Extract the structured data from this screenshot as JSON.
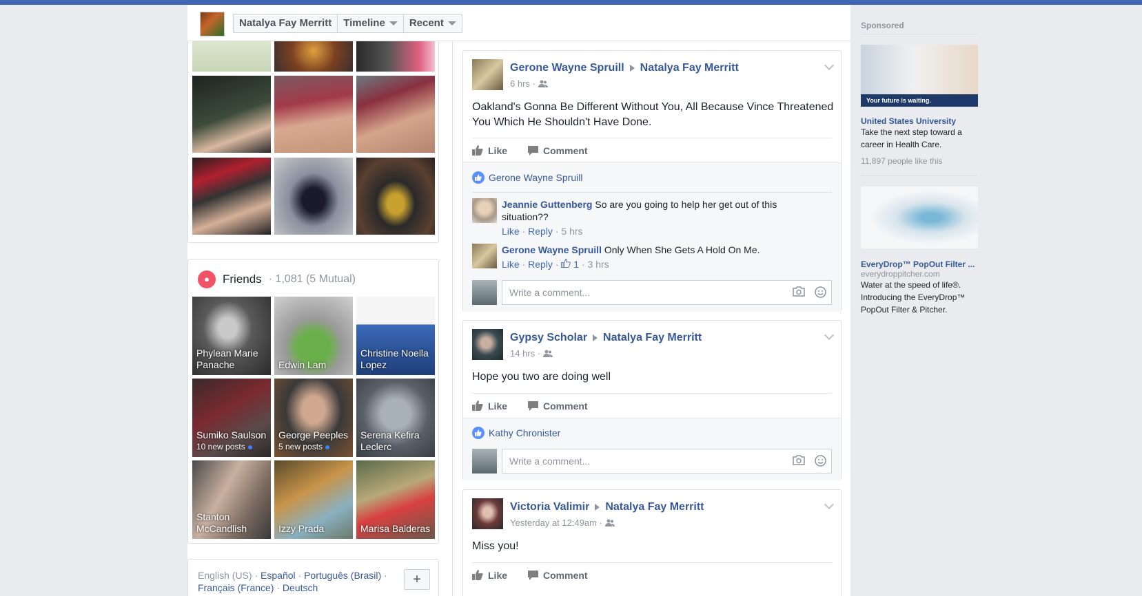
{
  "profile_bar": {
    "name": "Natalya Fay Merritt",
    "timeline": "Timeline",
    "recent": "Recent"
  },
  "friends": {
    "title": "Friends",
    "count": "· 1,081 (5 Mutual)",
    "items": [
      {
        "name": "Phylean Marie Panache",
        "sub": ""
      },
      {
        "name": "Edwin Lam",
        "sub": ""
      },
      {
        "name": "Christine Noella Lopez",
        "sub": ""
      },
      {
        "name": "Sumiko Saulson",
        "sub": "10 new posts"
      },
      {
        "name": "George Peeples",
        "sub": "5 new posts"
      },
      {
        "name": "Serena Kefira Leclerc",
        "sub": ""
      },
      {
        "name": "Stanton McCandlish",
        "sub": ""
      },
      {
        "name": "Izzy Prada",
        "sub": ""
      },
      {
        "name": "Marisa Balderas",
        "sub": ""
      }
    ]
  },
  "languages": {
    "current": "English (US)",
    "links": [
      "Español",
      "Português (Brasil)",
      "Français (France)",
      "Deutsch"
    ]
  },
  "actions": {
    "like": "Like",
    "comment": "Comment",
    "reply": "Reply",
    "write_placeholder": "Write a comment..."
  },
  "posts": [
    {
      "author": "Gerone Wayne Spruill",
      "target": "Natalya Fay Merritt",
      "time": "6 hrs ·",
      "text_line1": "Oakland's Gonna Be Different Without You, All Because Vince Threatened",
      "text_line2": "You Which He Shouldn't Have Done.",
      "liker": "Gerone Wayne Spruill",
      "comments": [
        {
          "author": "Jeannie Guttenberg",
          "text": "So are you going to help her get out of this situation??",
          "time": "5 hrs",
          "likes": ""
        },
        {
          "author": "Gerone Wayne Spruill",
          "text": "Only When She Gets A Hold On Me.",
          "time": "3 hrs",
          "likes": "1"
        }
      ]
    },
    {
      "author": "Gypsy Scholar",
      "target": "Natalya Fay Merritt",
      "time": "14 hrs ·",
      "text": "Hope you two are doing well",
      "liker": "Kathy Chronister"
    },
    {
      "author": "Victoria Valimir",
      "target": "Natalya Fay Merritt",
      "time": "Yesterday at 12:49am ·",
      "text": "Miss you!"
    }
  ],
  "ads": {
    "sponsored": "Sponsored",
    "ad1": {
      "banner": "Your future is waiting.",
      "title": "United States University",
      "desc": "Take the next step toward a career in Health Care.",
      "likes": "11,897 people like this"
    },
    "ad2": {
      "title": "EveryDrop™ PopOut Filter ...",
      "url": "everydroppitcher.com",
      "desc": "Water at the speed of life®. Introducing the EveryDrop™ PopOut Filter & Pitcher."
    }
  },
  "colors": {
    "brand": "#4267b2",
    "link": "#365899",
    "friends_badge": "#f35369"
  }
}
